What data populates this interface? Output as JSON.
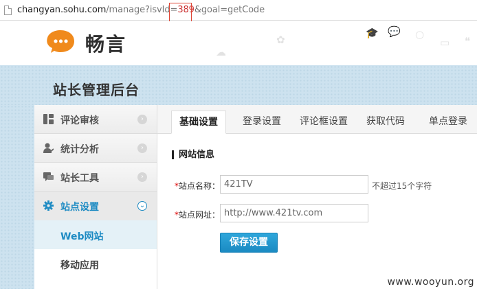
{
  "browser": {
    "url_prefix": "changyan.sohu.com",
    "url_path": "/manage?isvId=",
    "url_highlight": "389",
    "url_suffix": "&goal=getCode"
  },
  "header": {
    "logo_text": "畅言"
  },
  "banner": {
    "title": "站长管理后台"
  },
  "sidebar": {
    "items": [
      {
        "label": "评论审核",
        "icon": "grid-icon"
      },
      {
        "label": "统计分析",
        "icon": "user-stats-icon"
      },
      {
        "label": "站长工具",
        "icon": "chat-tools-icon"
      },
      {
        "label": "站点设置",
        "icon": "gear-icon"
      }
    ],
    "sub_items": [
      {
        "label": "Web网站"
      },
      {
        "label": "移动应用"
      }
    ]
  },
  "tabs": [
    {
      "label": "基础设置"
    },
    {
      "label": "登录设置"
    },
    {
      "label": "评论框设置"
    },
    {
      "label": "获取代码"
    },
    {
      "label": "单点登录"
    }
  ],
  "form": {
    "section_title": "网站信息",
    "site_name_label": "站点名称：",
    "site_name_value": "421TV",
    "site_name_hint": "不超过15个字符",
    "site_url_label": "站点网址：",
    "site_url_value": "http://www.421tv.com",
    "required_mark": "*",
    "save_label": "保存设置"
  },
  "watermark": "www.wooyun.org",
  "colors": {
    "accent": "#1e8bc3",
    "logo_orange": "#f08a1c",
    "banner_bg": "#cde2ef",
    "highlight_box": "#d43333"
  }
}
